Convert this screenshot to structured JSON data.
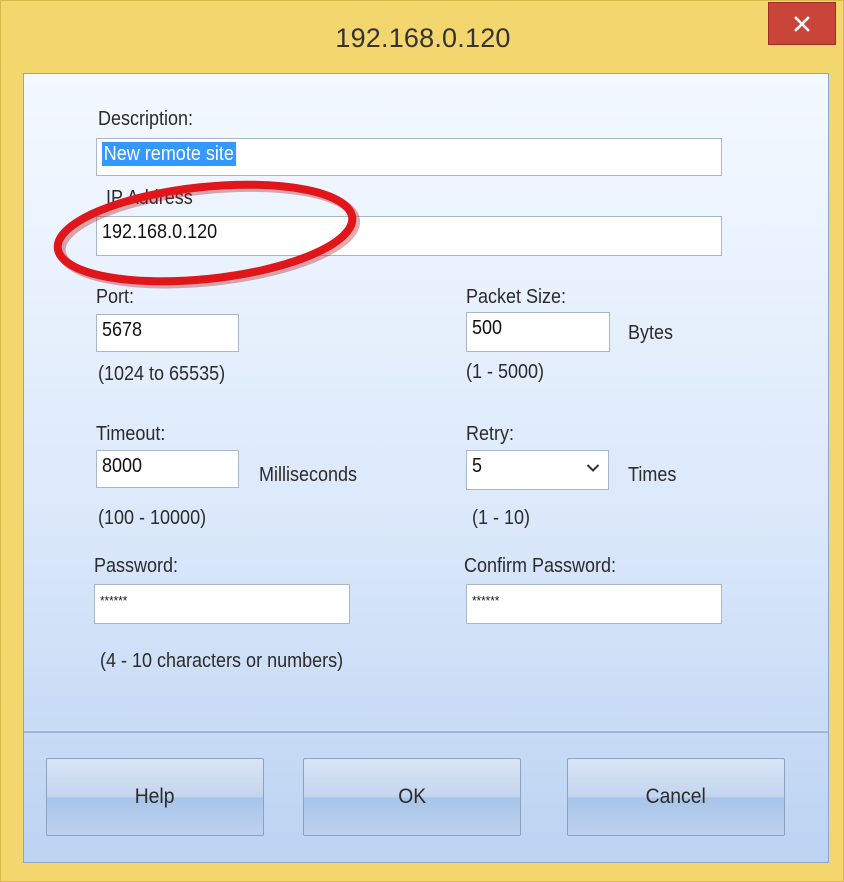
{
  "window": {
    "title": "192.168.0.120"
  },
  "description": {
    "label": "Description:",
    "value": "New remote site"
  },
  "ip": {
    "label": "IP Address",
    "value": "192.168.0.120"
  },
  "port": {
    "label": "Port:",
    "value": "5678",
    "hint": "(1024 to 65535)"
  },
  "packet": {
    "label": "Packet Size:",
    "value": "500",
    "unit": "Bytes",
    "hint": "(1 - 5000)"
  },
  "timeout": {
    "label": "Timeout:",
    "value": "8000",
    "unit": "Milliseconds",
    "hint": "(100 - 10000)"
  },
  "retry": {
    "label": "Retry:",
    "value": "5",
    "unit": "Times",
    "hint": "(1 - 10)"
  },
  "password": {
    "label": "Password:",
    "value": "******",
    "hint": "(4 - 10 characters or numbers)"
  },
  "confirm": {
    "label": "Confirm Password:",
    "value": "******"
  },
  "buttons": {
    "help": "Help",
    "ok": "OK",
    "cancel": "Cancel"
  },
  "colors": {
    "title_bar": "#f3d66d",
    "close": "#c9453a",
    "highlight_ring": "#e0161b",
    "selection": "#3399ff"
  },
  "icons": {
    "close": "close-icon",
    "combo": "chevron-down-icon"
  }
}
